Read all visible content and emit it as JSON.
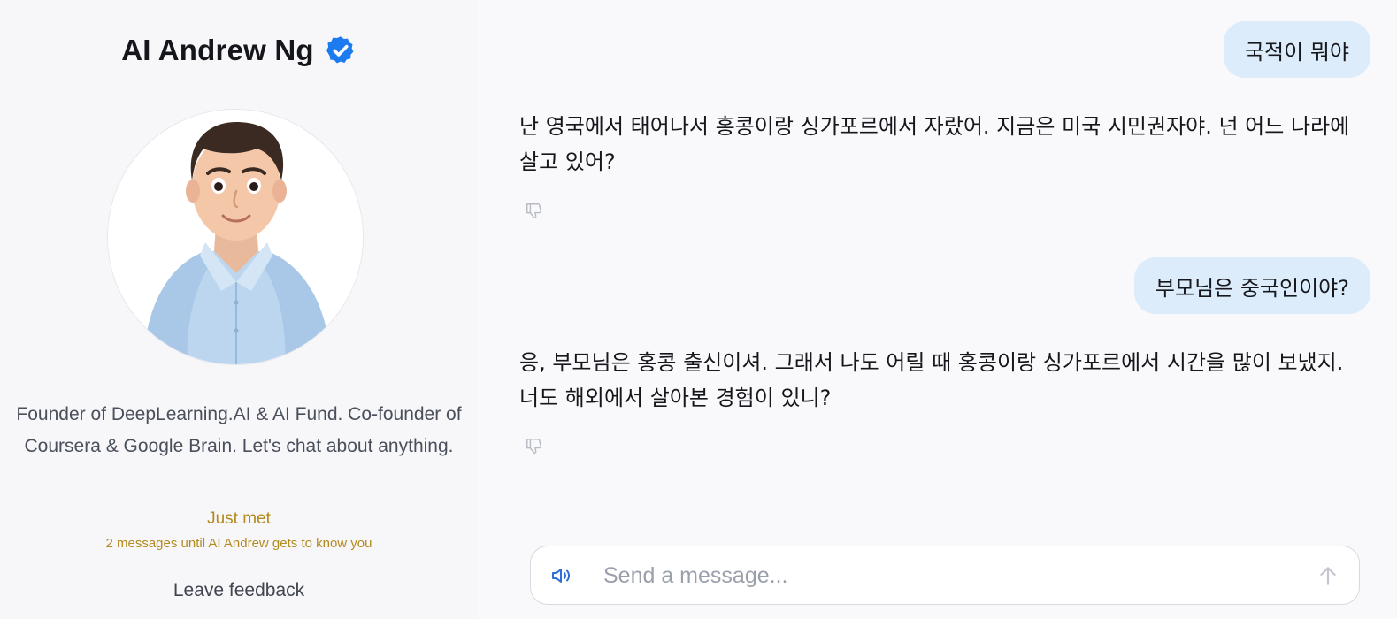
{
  "profile": {
    "name": "AI Andrew Ng",
    "bio": "Founder of DeepLearning.AI & AI Fund. Co-founder of Coursera & Google Brain. Let's chat about anything.",
    "status": "Just met",
    "status_detail": "2 messages until AI Andrew gets to know you",
    "feedback_label": "Leave feedback"
  },
  "chat": {
    "messages": [
      {
        "role": "user",
        "text": "국적이 뭐야"
      },
      {
        "role": "assistant",
        "text": "난 영국에서 태어나서 홍콩이랑 싱가포르에서 자랐어. 지금은 미국 시민권자야. 넌 어느 나라에 살고 있어?"
      },
      {
        "role": "user",
        "text": "부모님은 중국인이야?"
      },
      {
        "role": "assistant",
        "text": "응, 부모님은 홍콩 출신이셔. 그래서 나도 어릴 때 홍콩이랑 싱가포르에서 시간을 많이 보냈지. 너도 해외에서 살아본 경험이 있니?"
      }
    ],
    "input": {
      "placeholder": "Send a message...",
      "value": ""
    }
  },
  "icons": {
    "verified": "verified-badge-icon",
    "thumbs_down": "thumbs-down-icon",
    "speaker": "speaker-icon",
    "send": "arrow-up-icon"
  },
  "colors": {
    "verified_blue": "#1d7bf0",
    "user_bubble": "#dcecfb",
    "status_gold": "#b38a1f",
    "speaker_blue": "#2f6fd6"
  }
}
